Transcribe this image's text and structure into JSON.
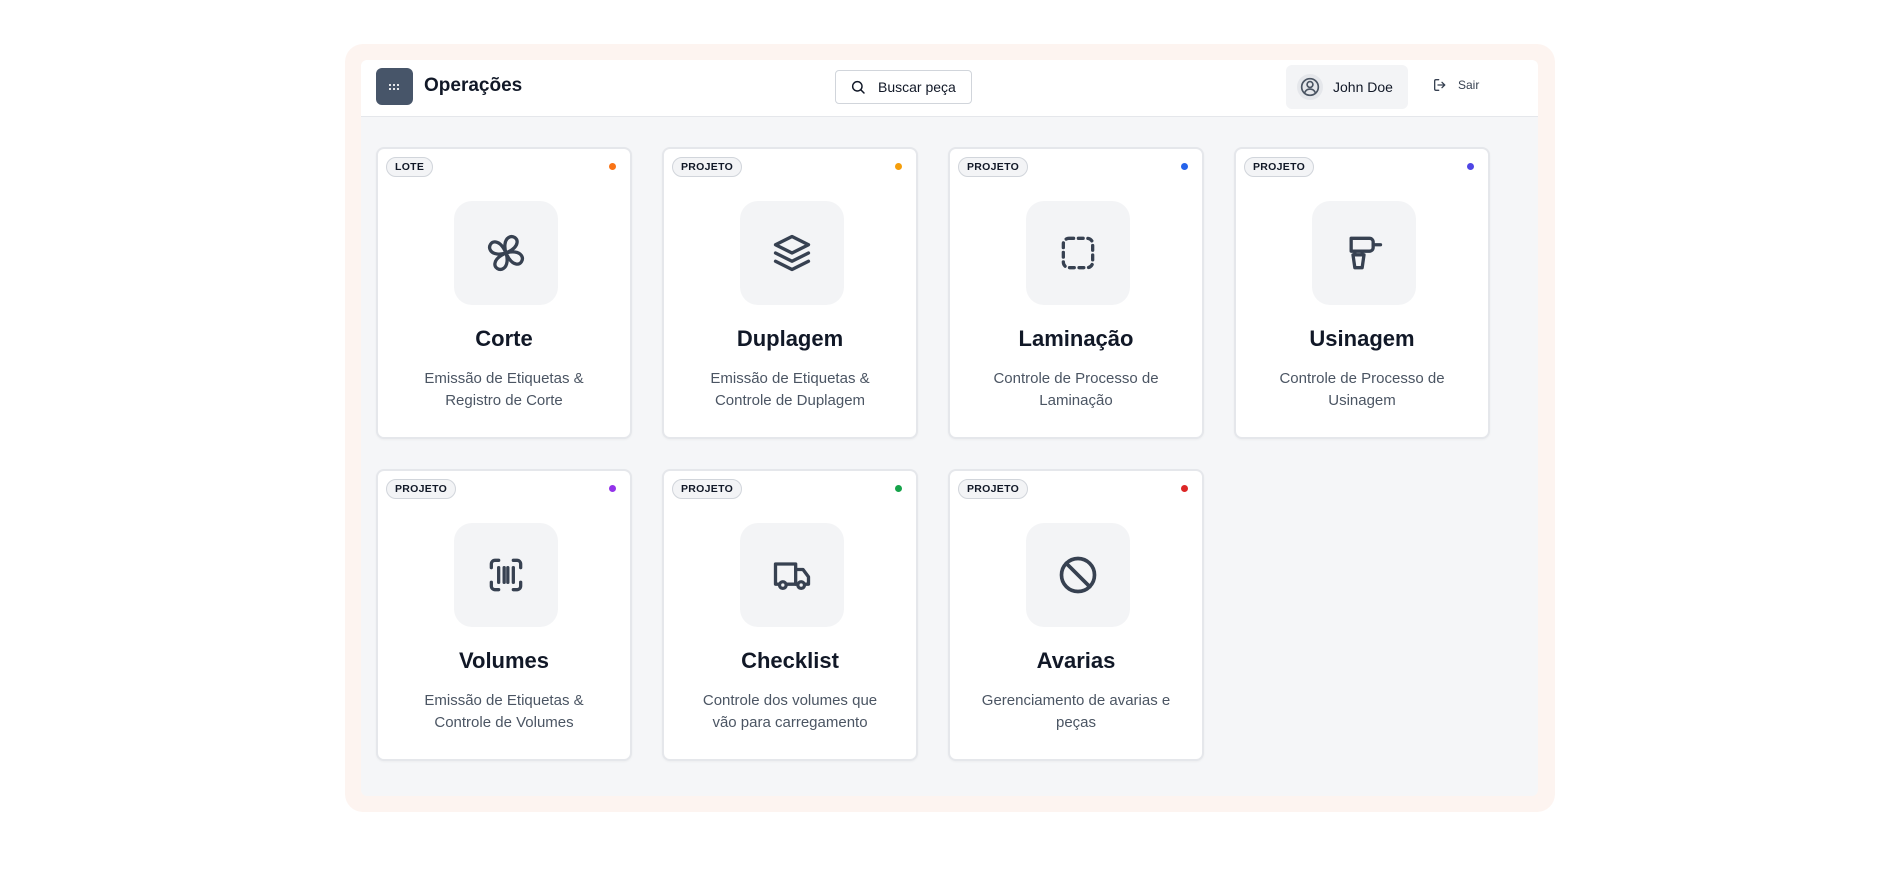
{
  "header": {
    "title": "Operações",
    "logo_icon": "grid-dots-icon",
    "search_label": "Buscar peça",
    "user_name": "John Doe",
    "logout_label": "Sair"
  },
  "cards": [
    {
      "badge": "LOTE",
      "title": "Corte",
      "desc": "Emissão de Etiquetas & Registro de Corte",
      "icon": "fan-icon",
      "dot_color": "#f97316"
    },
    {
      "badge": "PROJETO",
      "title": "Duplagem",
      "desc": "Emissão de Etiquetas & Controle de Duplagem",
      "icon": "layers-icon",
      "dot_color": "#f59e0b"
    },
    {
      "badge": "PROJETO",
      "title": "Laminação",
      "desc": "Controle de Processo de Laminação",
      "icon": "dashed-square-icon",
      "dot_color": "#2563eb"
    },
    {
      "badge": "PROJETO",
      "title": "Usinagem",
      "desc": "Controle de Processo de Usinagem",
      "icon": "drill-icon",
      "dot_color": "#4f46e5"
    },
    {
      "badge": "PROJETO",
      "title": "Volumes",
      "desc": "Emissão de Etiquetas & Controle de Volumes",
      "icon": "barcode-scan-icon",
      "dot_color": "#9333ea"
    },
    {
      "badge": "PROJETO",
      "title": "Checklist",
      "desc": "Controle dos volumes que vão para carregamento",
      "icon": "truck-icon",
      "dot_color": "#16a34a"
    },
    {
      "badge": "PROJETO",
      "title": "Avarias",
      "desc": "Gerenciamento de avarias e peças",
      "icon": "ban-icon",
      "dot_color": "#dc2626"
    }
  ]
}
